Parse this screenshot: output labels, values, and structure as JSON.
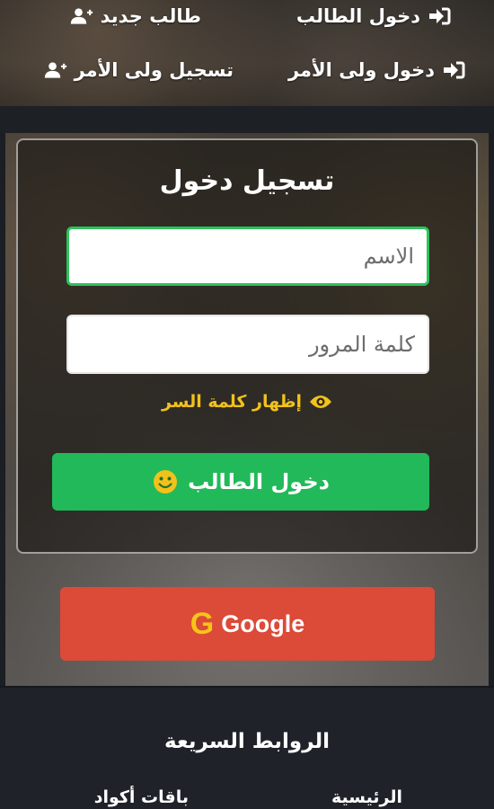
{
  "top_nav": {
    "student_login": "دخول الطالب",
    "new_student": "طالب جديد",
    "parent_login": "دخول ولى الأمر",
    "parent_register": "تسجيل ولى الأمر"
  },
  "login": {
    "title": "تسجيل دخول",
    "name_placeholder": "الاسم",
    "password_placeholder": "كلمة المرور",
    "show_password": "إظهار كلمة السر",
    "student_login_button": "دخول الطالب",
    "google_letter": "G",
    "google_button": "Google"
  },
  "footer": {
    "title": "الروابط السريعة",
    "links": [
      "الرئيسية",
      "باقات أكواد"
    ]
  },
  "colors": {
    "primary_green": "#22b95a",
    "google_red": "#dc4a38",
    "accent_yellow": "#f2c21b"
  },
  "icons": {
    "student_login": "sign-in-icon",
    "new_student": "user-plus-icon",
    "parent_login": "sign-in-icon",
    "parent_register": "user-plus-icon",
    "show_password": "eye-icon",
    "student_button": "smile-icon"
  }
}
